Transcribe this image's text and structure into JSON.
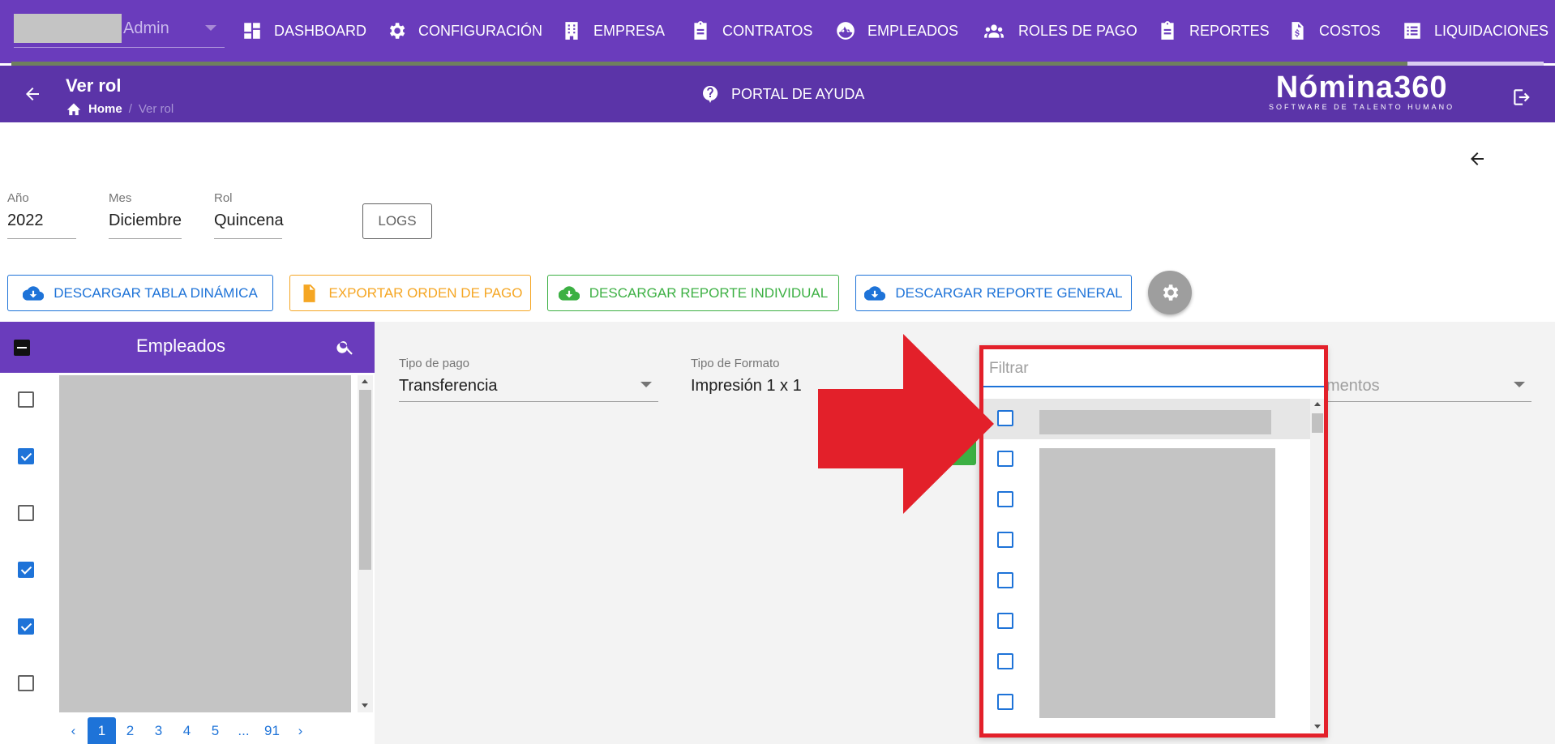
{
  "nav": {
    "user_label": "Admin",
    "items": [
      {
        "label": "DASHBOARD",
        "icon": "dashboard-icon"
      },
      {
        "label": "CONFIGURACIÓN",
        "icon": "gear-icon"
      },
      {
        "label": "EMPRESA",
        "icon": "building-icon"
      },
      {
        "label": "CONTRATOS",
        "icon": "clipboard-icon"
      },
      {
        "label": "EMPLEADOS",
        "icon": "face-icon"
      },
      {
        "label": "ROLES DE PAGO",
        "icon": "people-icon"
      },
      {
        "label": "REPORTES",
        "icon": "clipboard-icon"
      },
      {
        "label": "COSTOS",
        "icon": "invoice-dollar-icon"
      },
      {
        "label": "LIQUIDACIONES",
        "icon": "list-icon"
      }
    ]
  },
  "header": {
    "title": "Ver rol",
    "breadcrumb_home": "Home",
    "breadcrumb_sep": "/",
    "breadcrumb_current": "Ver rol",
    "help_label": "PORTAL DE AYUDA",
    "brand_name": "Nómina360",
    "brand_tagline": "SOFTWARE DE TALENTO HUMANO"
  },
  "filters": {
    "year_label": "Año",
    "year_value": "2022",
    "month_label": "Mes",
    "month_value": "Diciembre",
    "role_label": "Rol",
    "role_value": "Quincena",
    "logs_label": "LOGS"
  },
  "actions": {
    "pivot_label": "DESCARGAR TABLA DINÁMICA",
    "export_label": "EXPORTAR ORDEN DE PAGO",
    "individual_label": "DESCARGAR REPORTE INDIVIDUAL",
    "general_label": "DESCARGAR REPORTE GENERAL"
  },
  "colors": {
    "nav": "#6a3cbc",
    "subheader": "#5b34a8",
    "blue": "#1e73d8",
    "orange": "#f5a623",
    "green": "#3cb043",
    "highlight_red": "#e3202a"
  },
  "employees": {
    "title": "Empleados",
    "checks": [
      false,
      true,
      false,
      true,
      true,
      false
    ],
    "pages": [
      "1",
      "2",
      "3",
      "4",
      "5",
      "...",
      "91"
    ],
    "active_page": "1"
  },
  "payment": {
    "type_label": "Tipo de pago",
    "type_value": "Transferencia",
    "format_label": "Tipo de Formato",
    "format_value": "Impresión 1 x 1",
    "third_value_partial": "mentos"
  },
  "dropdown": {
    "filter_placeholder": "Filtrar",
    "rows": 8
  }
}
